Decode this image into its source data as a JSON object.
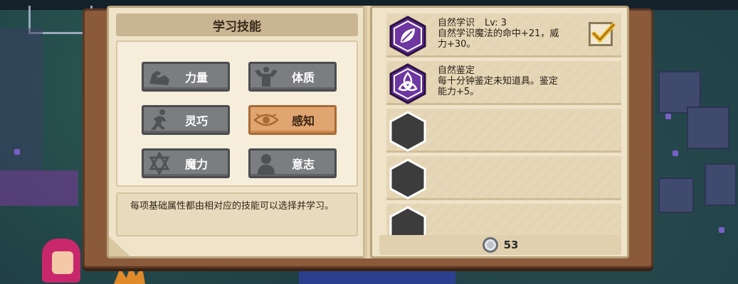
{
  "panel": {
    "title": "学习技能",
    "description": "每项基础属性都由相对应的技能可以选择并学习。"
  },
  "attributes": [
    {
      "label": "力量",
      "icon": "muscle-arm-icon",
      "selected": false
    },
    {
      "label": "体质",
      "icon": "bodybuilder-icon",
      "selected": false
    },
    {
      "label": "灵巧",
      "icon": "running-figure-icon",
      "selected": false
    },
    {
      "label": "感知",
      "icon": "eye-icon",
      "selected": true
    },
    {
      "label": "魔力",
      "icon": "hexagram-star-icon",
      "selected": false
    },
    {
      "label": "意志",
      "icon": "silhouette-head-icon",
      "selected": false
    }
  ],
  "skills": [
    {
      "name": "自然学识",
      "level": "Lv: 3",
      "desc_line1": "自然学识魔法的命中+21，威",
      "desc_line2": "力+30。",
      "icon": "leaf-icon",
      "checked": true
    },
    {
      "name": "自然鉴定",
      "level": "",
      "desc_line1": "每十分钟鉴定未知道具。鉴定",
      "desc_line2": "能力+5。",
      "icon": "triquetra-icon",
      "checked": false
    },
    {
      "locked": true
    },
    {
      "locked": true
    },
    {
      "locked": true
    }
  ],
  "currency": {
    "amount": "53",
    "icon": "silver-coin-icon"
  },
  "colors": {
    "button_gray": "#7b7d80",
    "button_selected": "#e0a570",
    "skill_icon_purple": "#5e2a8c",
    "page_paper": "#efe4c9",
    "book_cover": "#8a5a3a"
  }
}
